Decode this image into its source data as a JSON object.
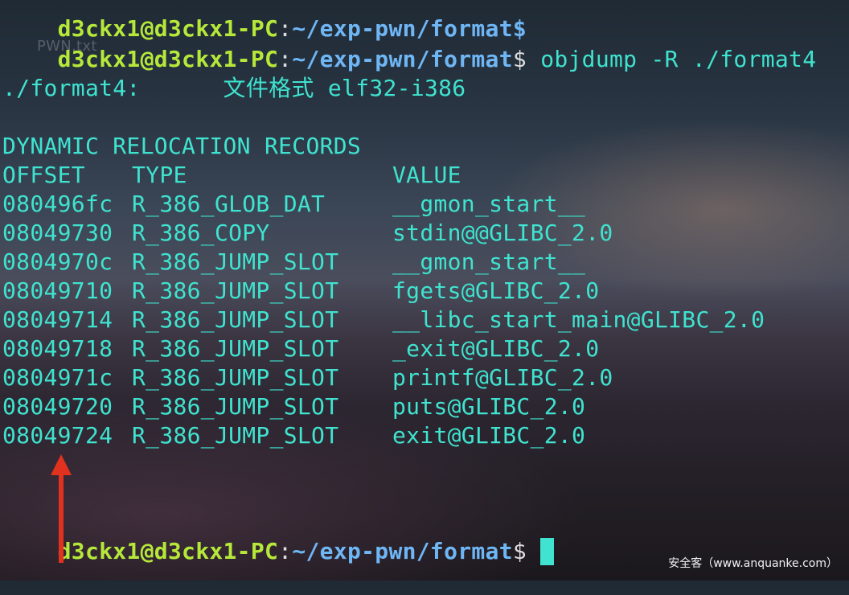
{
  "terminal": {
    "top_cut_line": {
      "user": "d3ckx1@d3ckx1-PC",
      "path": "~/exp-pwn/format$"
    },
    "prompt1": {
      "user": "d3ckx1@d3ckx1-PC",
      "sep": ":",
      "path": "~/exp-pwn/format",
      "dollar": "$",
      "command": " objdump -R ./format4"
    },
    "ghost_file": "PWN.txt",
    "file_format_line": "./format4:      文件格式 elf32-i386",
    "section_title": "DYNAMIC RELOCATION RECORDS",
    "headers": {
      "offset": "OFFSET",
      "type": "TYPE",
      "value": "VALUE"
    },
    "records": [
      {
        "offset": "080496fc",
        "type": "R_386_GLOB_DAT",
        "value": "__gmon_start__"
      },
      {
        "offset": "08049730",
        "type": "R_386_COPY",
        "value": "stdin@@GLIBC_2.0"
      },
      {
        "offset": "0804970c",
        "type": "R_386_JUMP_SLOT",
        "value": "__gmon_start__"
      },
      {
        "offset": "08049710",
        "type": "R_386_JUMP_SLOT",
        "value": "fgets@GLIBC_2.0"
      },
      {
        "offset": "08049714",
        "type": "R_386_JUMP_SLOT",
        "value": "__libc_start_main@GLIBC_2.0"
      },
      {
        "offset": "08049718",
        "type": "R_386_JUMP_SLOT",
        "value": "_exit@GLIBC_2.0"
      },
      {
        "offset": "0804971c",
        "type": "R_386_JUMP_SLOT",
        "value": "printf@GLIBC_2.0"
      },
      {
        "offset": "08049720",
        "type": "R_386_JUMP_SLOT",
        "value": "puts@GLIBC_2.0"
      },
      {
        "offset": "08049724",
        "type": "R_386_JUMP_SLOT",
        "value": "exit@GLIBC_2.0"
      }
    ],
    "prompt2": {
      "user": "d3ckx1@d3ckx1-PC",
      "sep": ":",
      "path": "~/exp-pwn/format",
      "dollar": "$"
    }
  },
  "annotation": {
    "arrow_color": "#e0321e"
  },
  "watermark": "安全客（www.anquanke.com）",
  "colors": {
    "text": "#3fe3cf",
    "prompt_user": "#b6e83a",
    "prompt_path": "#6fb6f5"
  }
}
